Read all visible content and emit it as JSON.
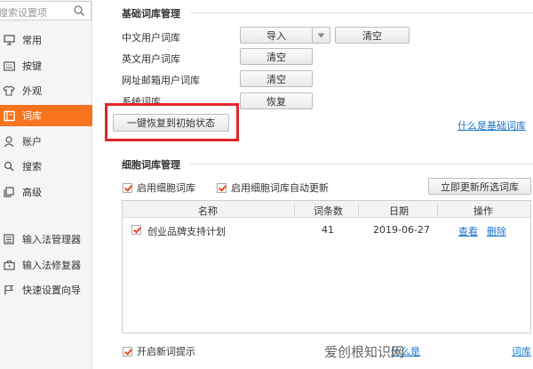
{
  "sidebar": {
    "search_placeholder": "搜索设置项",
    "items": [
      {
        "label": "常用",
        "icon": "monitor-icon",
        "active": false
      },
      {
        "label": "按键",
        "icon": "keyboard-icon",
        "active": false
      },
      {
        "label": "外观",
        "icon": "shirt-icon",
        "active": false
      },
      {
        "label": "词库",
        "icon": "book-icon",
        "active": true
      },
      {
        "label": "账户",
        "icon": "user-icon",
        "active": false
      },
      {
        "label": "搜索",
        "icon": "search-icon",
        "active": false
      },
      {
        "label": "高级",
        "icon": "layers-icon",
        "active": false
      },
      {
        "label": "输入法管理器",
        "icon": "list-icon",
        "active": false
      },
      {
        "label": "输入法修复器",
        "icon": "toolbox-icon",
        "active": false
      },
      {
        "label": "快速设置向导",
        "icon": "flag-icon",
        "active": false
      }
    ]
  },
  "basic_lexicon": {
    "title": "基础词库管理",
    "rows": [
      {
        "label": "中文用户词库",
        "import_label": "导入",
        "clear_label": "清空"
      },
      {
        "label": "英文用户词库",
        "clear_label": "清空"
      },
      {
        "label": "网址邮箱用户词库",
        "clear_label": "清空"
      },
      {
        "label": "系统词库",
        "restore_label": "恢复"
      }
    ],
    "reset_all_label": "一键恢复到初始状态",
    "what_is_link": "什么是基础词库"
  },
  "cell_lexicon": {
    "title": "细胞词库管理",
    "enable_label": "启用细胞词库",
    "enable_checked": true,
    "auto_update_label": "启用细胞词库自动更新",
    "auto_update_checked": true,
    "update_now_label": "立即更新所选词库",
    "table": {
      "headers": [
        "名称",
        "词条数",
        "日期",
        "操作"
      ],
      "rows": [
        {
          "checked": true,
          "name": "创业品牌支持计划",
          "count": "41",
          "date": "2019-06-27",
          "view_label": "查看",
          "delete_label": "删除"
        }
      ]
    }
  },
  "footer": {
    "new_word_tip_label": "开启新词提示",
    "new_word_tip_checked": true,
    "link_prefix": "什么是",
    "link_suffix": "词库"
  },
  "watermark": "爱创根知识网",
  "colors": {
    "accent": "#f7731e",
    "link": "#1a73c9",
    "highlight_frame": "#e0262a"
  }
}
